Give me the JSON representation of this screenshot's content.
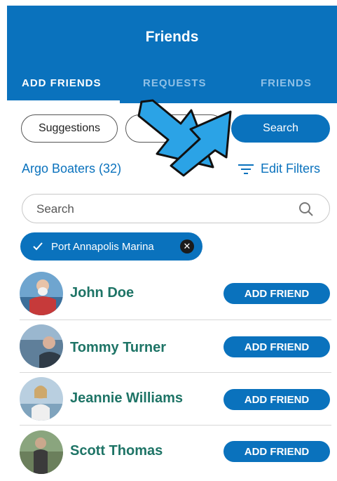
{
  "header": {
    "title": "Friends"
  },
  "tabs": [
    {
      "label": "ADD FRIENDS"
    },
    {
      "label": "REQUESTS"
    },
    {
      "label": "FRIENDS"
    }
  ],
  "filters_row": {
    "suggestions_label": "Suggestions",
    "search_button_label": "Search"
  },
  "group": {
    "label": "Argo Boaters (32)"
  },
  "edit_filters_label": "Edit Filters",
  "search": {
    "placeholder": "Search"
  },
  "chip": {
    "label": "Port Annapolis Marina"
  },
  "friends": [
    {
      "name": "John Doe",
      "button": "ADD FRIEND"
    },
    {
      "name": "Tommy Turner",
      "button": "ADD FRIEND"
    },
    {
      "name": "Jeannie Williams",
      "button": "ADD FRIEND"
    },
    {
      "name": "Scott Thomas",
      "button": "ADD FRIEND"
    }
  ],
  "colors": {
    "brand": "#0a72bd",
    "name_text": "#1e7466",
    "arrow": "#2ba3e6"
  }
}
